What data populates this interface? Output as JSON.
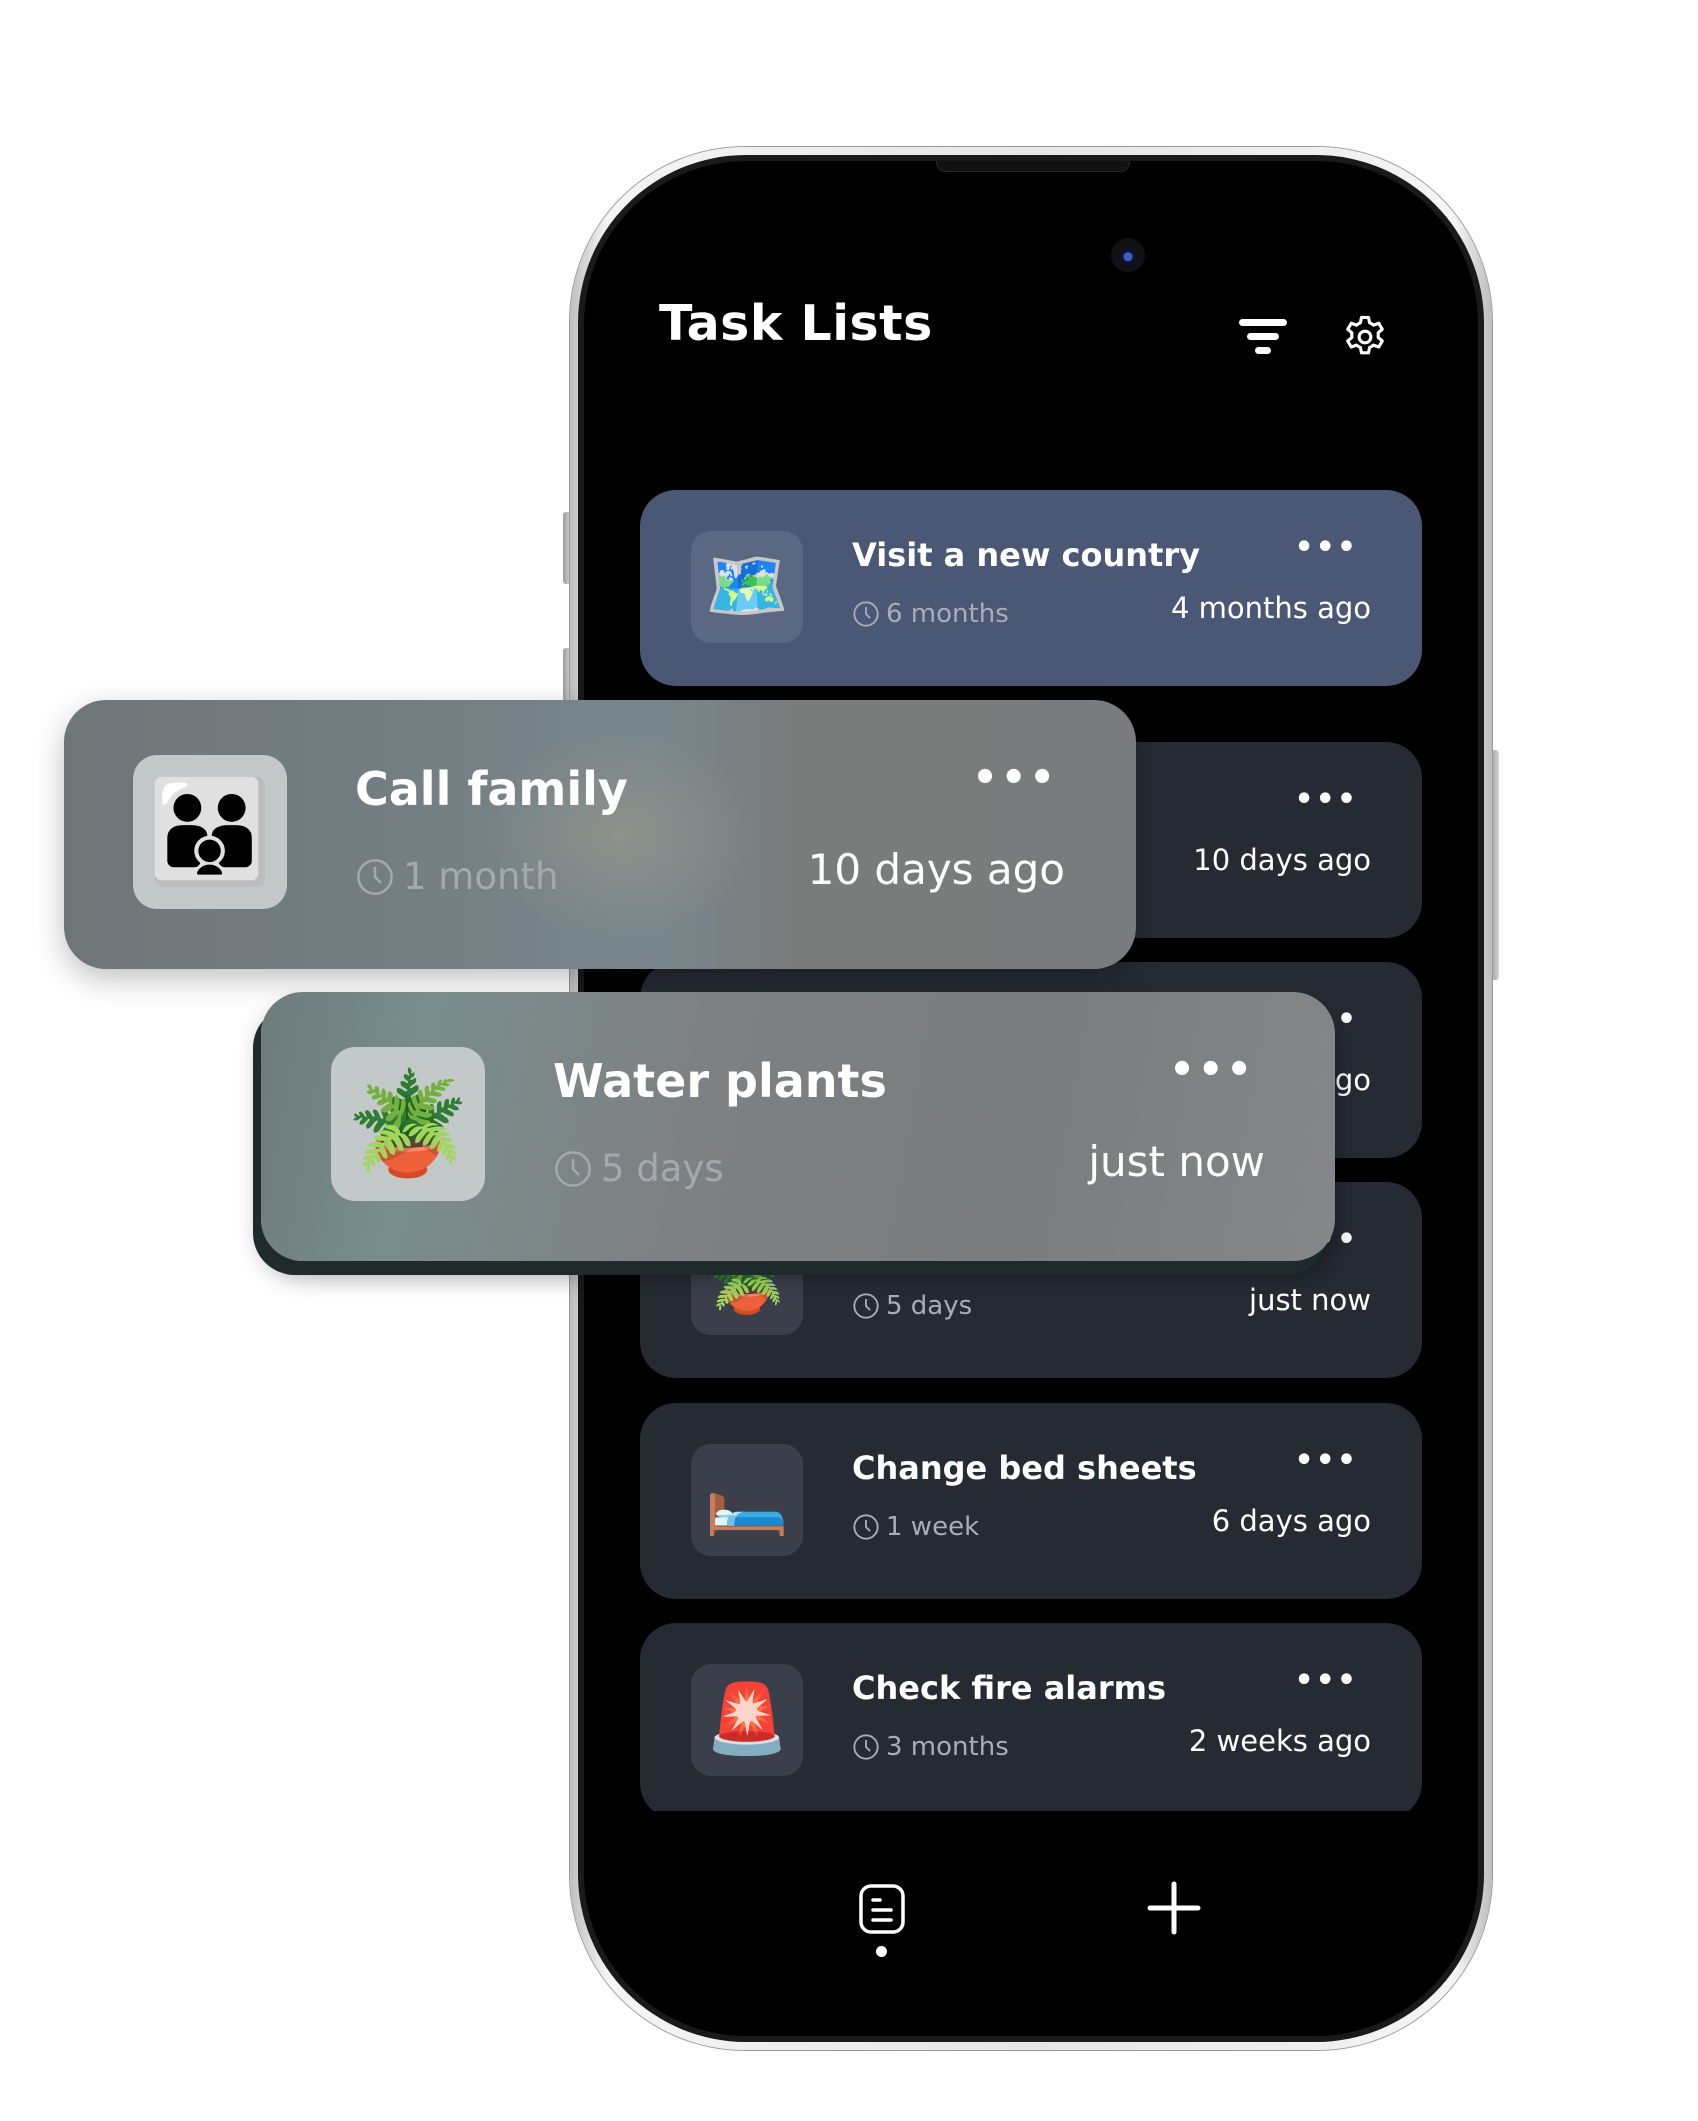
{
  "header": {
    "title": "Task Lists",
    "filter_icon": "filter-icon",
    "settings_icon": "gear-icon"
  },
  "tasks": [
    {
      "emoji": "🗺️",
      "icon": "world-map-icon",
      "title": "Visit a new country",
      "interval": "6 months",
      "last_done": "4 months ago",
      "highlighted": true
    },
    {
      "emoji": "",
      "icon": "",
      "title": "",
      "interval": "",
      "last_done": "10 days ago",
      "highlighted": false
    },
    {
      "emoji": "",
      "icon": "",
      "title": "",
      "interval": "",
      "last_done": "go",
      "highlighted": false
    },
    {
      "emoji": "🪴",
      "icon": "potted-plant-icon",
      "title": "",
      "interval": "5 days",
      "last_done": "just now",
      "highlighted": false
    },
    {
      "emoji": "🛏️",
      "icon": "bed-icon",
      "title": "Change bed sheets",
      "interval": "1 week",
      "last_done": "6 days ago",
      "highlighted": false
    },
    {
      "emoji": "🚨",
      "icon": "siren-icon",
      "title": "Check fire alarms",
      "interval": "3 months",
      "last_done": "2 weeks ago",
      "highlighted": false
    }
  ],
  "more_label": "•••",
  "dragged_cards": [
    {
      "emoji": "👪",
      "icon": "family-icon",
      "title": "Call family",
      "interval": "1 month",
      "last_done": "10 days ago"
    },
    {
      "emoji": "🪴",
      "icon": "potted-plant-icon",
      "title": "Water plants",
      "interval": "5 days",
      "last_done": "just now"
    }
  ],
  "bottom_nav": {
    "list_icon": "list-icon",
    "add_icon": "plus-icon",
    "active": "list"
  },
  "colors": {
    "card": "#262a33",
    "card_highlight": "#4a5875",
    "screen_bg": "#000000"
  }
}
